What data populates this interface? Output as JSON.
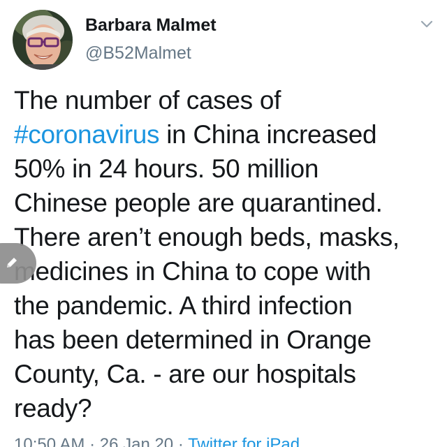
{
  "user": {
    "display_name": "Barbara Malmet",
    "handle": "@B52Malmet"
  },
  "tweet": {
    "lines": [
      {
        "pre": "The number of cases of",
        "hashtag": "",
        "post": ""
      },
      {
        "pre": "",
        "hashtag": "#coronavirus",
        "post": " in China increased"
      },
      {
        "pre": "50% in 24 hours. 50 million",
        "hashtag": "",
        "post": ""
      },
      {
        "pre": "Chinese people are quarantined.",
        "hashtag": "",
        "post": ""
      },
      {
        "pre": "There aren’t enough beds, masks,",
        "hashtag": "",
        "post": ""
      },
      {
        "pre": "medicines in China to cope with",
        "hashtag": "",
        "post": ""
      },
      {
        "pre": "the pandemic. A third infection",
        "hashtag": "",
        "post": ""
      },
      {
        "pre": "has been determined in Orange",
        "hashtag": "",
        "post": ""
      },
      {
        "pre": "County, Ca. - are our hospitals",
        "hashtag": "",
        "post": ""
      },
      {
        "pre": "ready?",
        "hashtag": "",
        "post": ""
      }
    ]
  },
  "meta": {
    "time": "10:50 AM",
    "sep1": " · ",
    "date": "26 Jan 20",
    "sep2": " · ",
    "source": "Twitter for iPad"
  },
  "icons": {
    "caret": "chevron-down-icon",
    "edit": "pencil-icon",
    "avatar": "avatar-photo"
  },
  "colors": {
    "text": "#14171a",
    "muted": "#657786",
    "link": "#1b95e0"
  }
}
